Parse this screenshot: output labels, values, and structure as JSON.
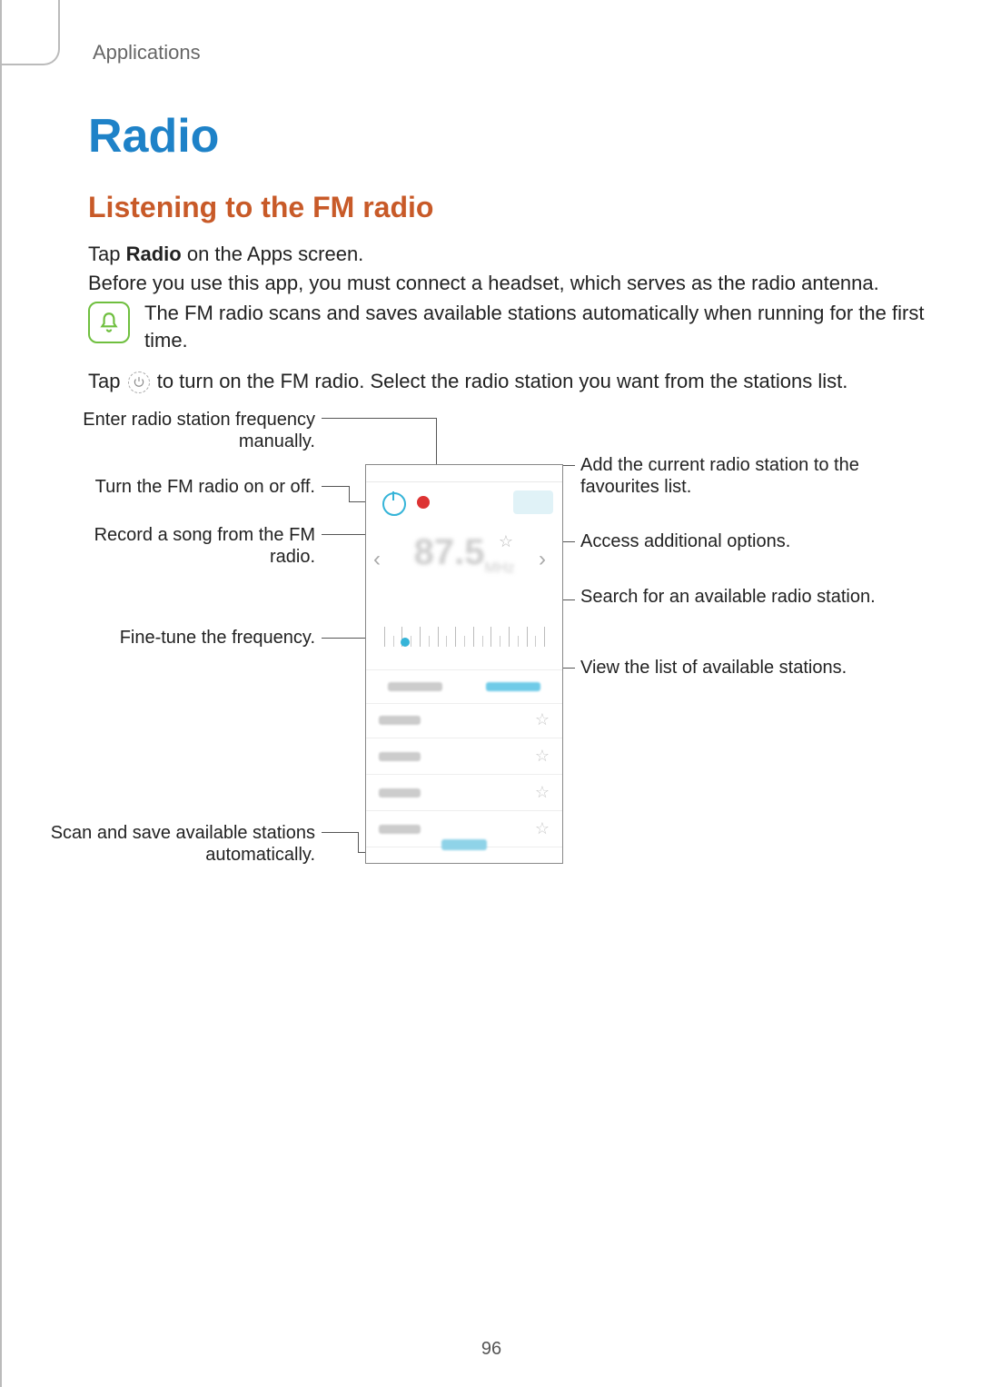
{
  "section": "Applications",
  "title": "Radio",
  "subtitle": "Listening to the FM radio",
  "para1_pre": "Tap ",
  "para1_bold": "Radio",
  "para1_post": " on the Apps screen.",
  "para2": "Before you use this app, you must connect a headset, which serves as the radio antenna.",
  "note": "The FM radio scans and saves available stations automatically when running for the first time.",
  "para3_pre": "Tap ",
  "para3_post": " to turn on the FM radio. Select the radio station you want from the stations list.",
  "callouts": {
    "manual_freq": "Enter radio station frequency manually.",
    "onoff": "Turn the FM radio on or off.",
    "record": "Record a song from the FM radio.",
    "finetune": "Fine-tune the frequency.",
    "scan": "Scan and save available stations automatically.",
    "favourite": "Add the current radio station to the favourites list.",
    "options": "Access additional options.",
    "search": "Search for an available radio station.",
    "list": "View the list of available stations."
  },
  "phone": {
    "freq": "87.5",
    "freq_unit": "MHz"
  },
  "page_number": "96"
}
